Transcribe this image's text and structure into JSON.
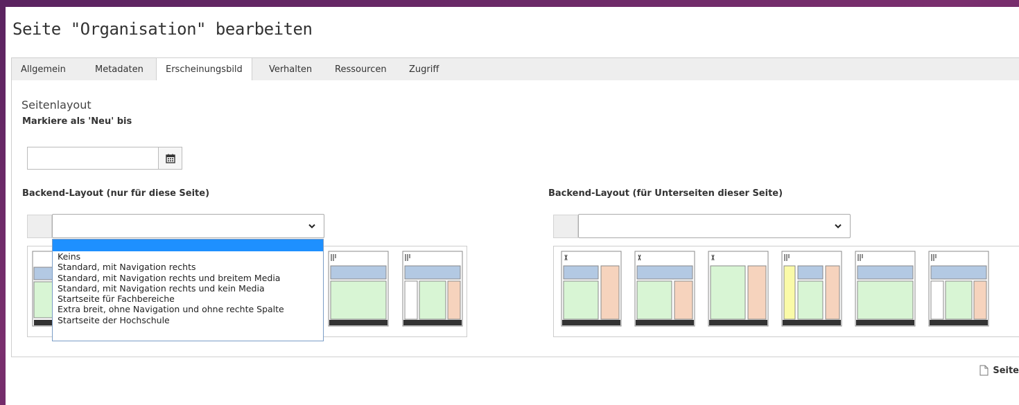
{
  "page": {
    "title": "Seite \"Organisation\" bearbeiten"
  },
  "tabs": [
    {
      "label": "Allgemein",
      "active": false
    },
    {
      "label": "Metadaten",
      "active": false
    },
    {
      "label": "Erscheinungsbild",
      "active": true
    },
    {
      "label": "Verhalten",
      "active": false
    },
    {
      "label": "Ressourcen",
      "active": false
    },
    {
      "label": "Zugriff",
      "active": false
    }
  ],
  "section": {
    "title": "Seitenlayout",
    "new_until_label": "Markiere als 'Neu' bis",
    "new_until_value": "",
    "backend_layout_label": "Backend-Layout (nur für diese Seite)",
    "backend_layout_sub_label": "Backend-Layout (für Unterseiten dieser Seite)",
    "backend_layout_value": "",
    "backend_layout_sub_value": ""
  },
  "dropdown": {
    "options": [
      "",
      "Keins",
      "Standard, mit Navigation rechts",
      "Standard, mit Navigation rechts und breitem Media",
      "Standard, mit Navigation rechts und kein Media",
      "Startseite für Fachbereiche",
      "Extra breit, ohne Navigation und ohne rechte Spalte",
      "Startseite der Hochschule"
    ],
    "highlighted_index": 0
  },
  "footer": {
    "link_label": "Seite"
  },
  "colors": {
    "header_blue": "#b3c9e3",
    "content_green": "#d8f5d4",
    "sidebar_peach": "#f6d3bd",
    "accent_yellow": "#fafaa8",
    "footer_dark": "#333333",
    "highlight": "#1e90ff"
  }
}
